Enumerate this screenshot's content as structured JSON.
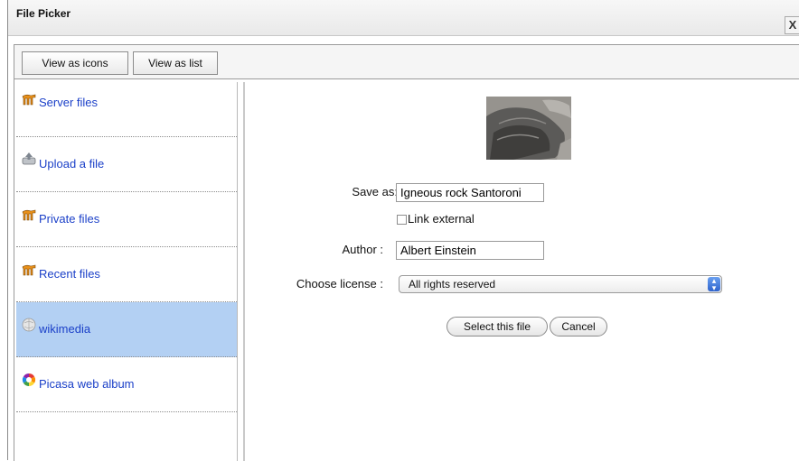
{
  "dialog": {
    "title": "File Picker",
    "close_label": "X"
  },
  "toolbar": {
    "view_icons_label": "View as icons",
    "view_list_label": "View as list"
  },
  "sidebar": {
    "items": [
      {
        "label": "Server files",
        "icon": "moodle-icon",
        "selected": false
      },
      {
        "label": "Upload a file",
        "icon": "upload-icon",
        "selected": false
      },
      {
        "label": "Private files",
        "icon": "moodle-icon",
        "selected": false
      },
      {
        "label": "Recent files",
        "icon": "moodle-icon",
        "selected": false
      },
      {
        "label": "wikimedia",
        "icon": "wikimedia-icon",
        "selected": true
      },
      {
        "label": "Picasa web album",
        "icon": "picasa-icon",
        "selected": false
      }
    ]
  },
  "main": {
    "save_as": {
      "label": "Save as:",
      "value": "Igneous rock Santoroni"
    },
    "link_external": {
      "label": "Link external",
      "checked": false
    },
    "author": {
      "label": "Author :",
      "value": "Albert Einstein"
    },
    "license": {
      "label": "Choose license :",
      "value": "All rights reserved"
    },
    "select_button_label": "Select this file",
    "cancel_button_label": "Cancel"
  },
  "colors": {
    "link": "#1a3fc8",
    "selected_bg": "#b3d0f3",
    "select_arrow": "#2e63cc"
  }
}
